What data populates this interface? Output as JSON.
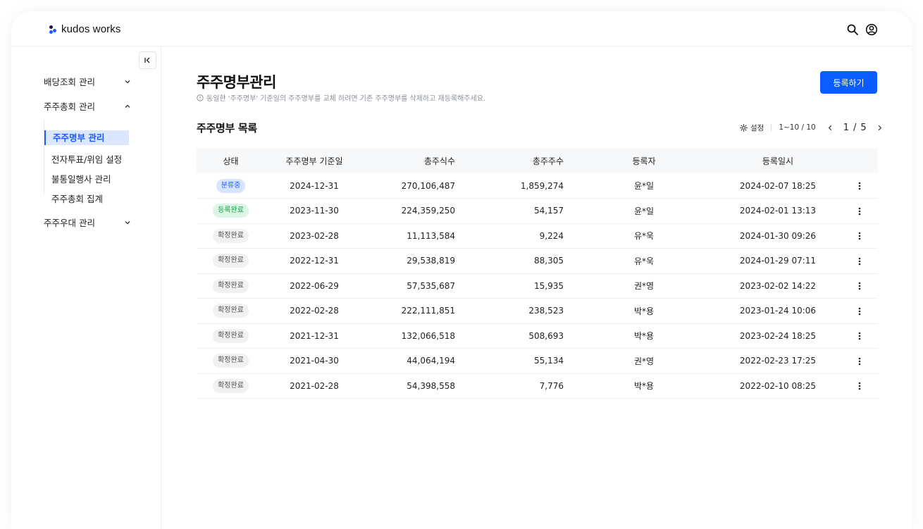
{
  "app": {
    "logo_text": "kudos works"
  },
  "colors": {
    "accent": "#0a5cff",
    "status_blue": "#1a5cff",
    "status_green": "#17a34a"
  },
  "sidebar": {
    "groups": [
      {
        "label": "배당조회 관리"
      },
      {
        "label": "주주총회 관리"
      },
      {
        "label": "주주우대 관리"
      }
    ],
    "sub_items": [
      {
        "label": "주주명부 관리",
        "active": true
      },
      {
        "label": "전자투표/위임 설정"
      },
      {
        "label": "불통일행사 관리"
      },
      {
        "label": "주주총회 집계"
      }
    ]
  },
  "page": {
    "title": "주주명부관리",
    "notice": "동일한 '주주명부' 기준일의 주주명부를 교체 하려면 기존 주주명부를 삭제하고 재등록해주세요.",
    "register_label": "등록하기",
    "section_title": "주주명부 목록",
    "settings_label": "설정",
    "range_label": "1~10 / 10",
    "current_page": "1",
    "page_separator": "/",
    "total_pages": "5"
  },
  "table": {
    "headers": [
      "상태",
      "주주명부 기준일",
      "총주식수",
      "총주주수",
      "등록자",
      "등록일시"
    ],
    "rows": [
      {
        "status": "분류중",
        "status_type": "blue",
        "date": "2024-12-31",
        "shares": "270,106,487",
        "holders": "1,859,274",
        "registrant": "윤*일",
        "registered_at": "2024-02-07 18:25"
      },
      {
        "status": "등록완료",
        "status_type": "green",
        "date": "2023-11-30",
        "shares": "224,359,250",
        "holders": "54,157",
        "registrant": "윤*일",
        "registered_at": "2024-02-01 13:13"
      },
      {
        "status": "확정완료",
        "status_type": "gray",
        "date": "2023-02-28",
        "shares": "11,113,584",
        "holders": "9,224",
        "registrant": "유*욱",
        "registered_at": "2024-01-30 09:26"
      },
      {
        "status": "확정완료",
        "status_type": "gray",
        "date": "2022-12-31",
        "shares": "29,538,819",
        "holders": "88,305",
        "registrant": "유*욱",
        "registered_at": "2024-01-29 07:11"
      },
      {
        "status": "확정완료",
        "status_type": "gray",
        "date": "2022-06-29",
        "shares": "57,535,687",
        "holders": "15,935",
        "registrant": "권*영",
        "registered_at": "2023-02-02 14:22"
      },
      {
        "status": "확정완료",
        "status_type": "gray",
        "date": "2022-02-28",
        "shares": "222,111,851",
        "holders": "238,523",
        "registrant": "박*용",
        "registered_at": "2023-01-24 10:06"
      },
      {
        "status": "확정완료",
        "status_type": "gray",
        "date": "2021-12-31",
        "shares": "132,066,518",
        "holders": "508,693",
        "registrant": "박*용",
        "registered_at": "2023-02-24 18:25"
      },
      {
        "status": "확정완료",
        "status_type": "gray",
        "date": "2021-04-30",
        "shares": "44,064,194",
        "holders": "55,134",
        "registrant": "권*영",
        "registered_at": "2022-02-23 17:25"
      },
      {
        "status": "확정완료",
        "status_type": "gray",
        "date": "2021-02-28",
        "shares": "54,398,558",
        "holders": "7,776",
        "registrant": "박*용",
        "registered_at": "2022-02-10 08:25"
      }
    ]
  }
}
